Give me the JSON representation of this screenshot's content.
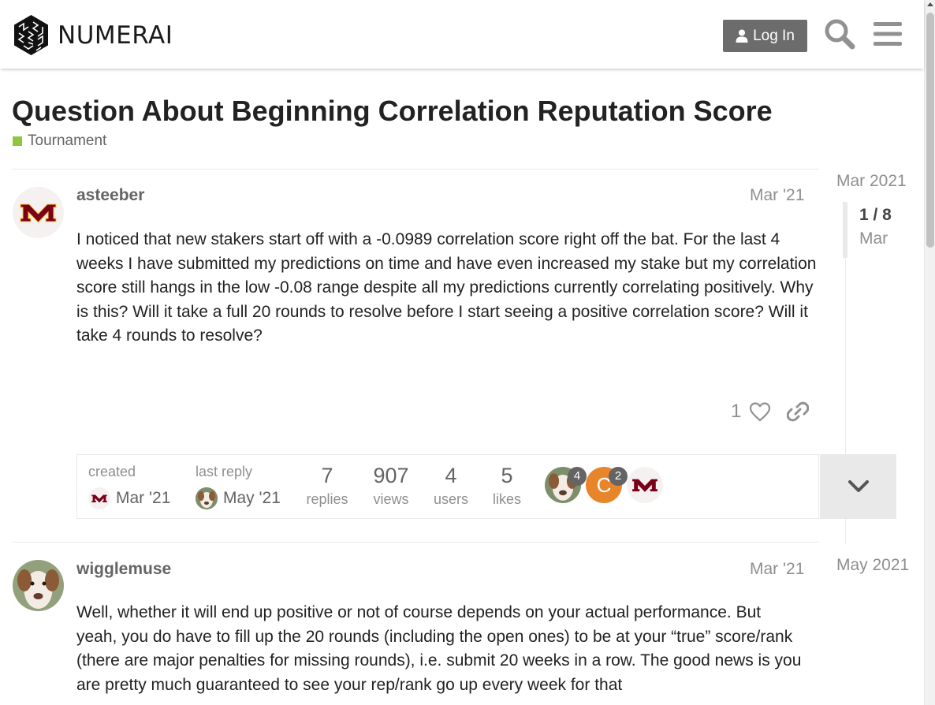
{
  "header": {
    "logo_text": "NUMERAI",
    "login_label": "Log In",
    "icons": [
      "numerai-logo-icon",
      "user-icon",
      "search-icon",
      "hamburger-menu-icon"
    ]
  },
  "topic": {
    "title": "Question About Beginning Correlation Reputation Score",
    "category": "Tournament",
    "category_color": "#8ec63f"
  },
  "posts": [
    {
      "username": "asteeber",
      "date": "Mar '21",
      "body": "I noticed that new stakers start off with a -0.0989 correlation score right off the bat. For the last 4 weeks I have submitted my predictions on time and have even increased my stake but my correlation score still hangs in the low -0.08 range despite all my predictions currently correlating positively. Why is this? Will it take a full 20 rounds to resolve before I start seeing a positive correlation score? Will it take 4 rounds to resolve?",
      "likes": "1"
    },
    {
      "username": "wigglemuse",
      "date": "Mar '21",
      "body": "Well, whether it will end up positive or not of course depends on your actual performance. But yeah, you do have to fill up the 20 rounds (including the open ones) to be at your “true” score/rank (there are major penalties for missing rounds), i.e. submit 20 weeks in a row. The good news is you are pretty much guaranteed to see your rep/rank go up every week for that"
    }
  ],
  "topic_map": {
    "created_label": "created",
    "created_date": "Mar '21",
    "last_reply_label": "last reply",
    "last_reply_date": "May '21",
    "stats": [
      {
        "value": "7",
        "label": "replies"
      },
      {
        "value": "907",
        "label": "views"
      },
      {
        "value": "4",
        "label": "users"
      },
      {
        "value": "5",
        "label": "likes"
      }
    ],
    "participants": [
      {
        "count": "4"
      },
      {
        "initial": "C",
        "count": "2",
        "color": "#e8852b"
      },
      {}
    ]
  },
  "timeline": {
    "start_date": "Mar 2021",
    "counter": "1 / 8",
    "current_sub": "Mar",
    "end_date": "May 2021"
  }
}
